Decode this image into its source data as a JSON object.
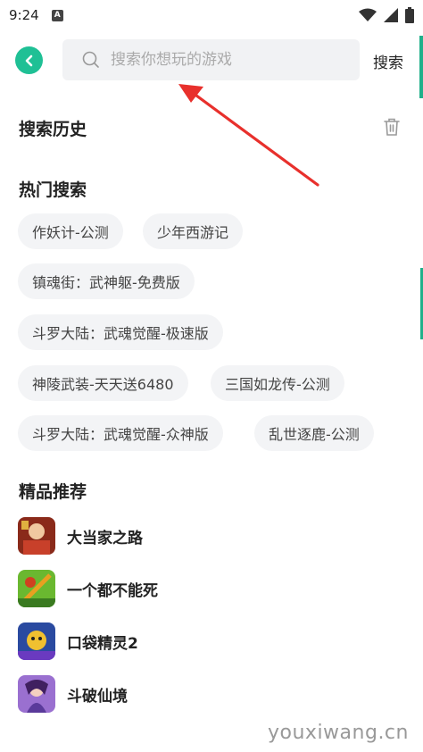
{
  "status_bar": {
    "time": "9:24",
    "notification_icon": "A"
  },
  "header": {
    "search_placeholder": "搜索你想玩的游戏",
    "search_button": "搜索"
  },
  "history": {
    "title": "搜索历史"
  },
  "hot": {
    "title": "热门搜索",
    "tags": [
      "作妖计-公测",
      "少年西游记",
      "镇魂街：武神躯-免费版",
      "斗罗大陆：武魂觉醒-极速版",
      "神陵武装-天天送6480",
      "三国如龙传-公测",
      "斗罗大陆：武魂觉醒-众神版",
      "乱世逐鹿-公测"
    ]
  },
  "featured": {
    "title": "精品推荐",
    "items": [
      {
        "name": "大当家之路"
      },
      {
        "name": "一个都不能死"
      },
      {
        "name": "口袋精灵2"
      },
      {
        "name": "斗破仙境"
      }
    ]
  },
  "watermark": "youxiwang.cn",
  "colors": {
    "accent": "#1fc095",
    "arrow": "#e8302c"
  }
}
